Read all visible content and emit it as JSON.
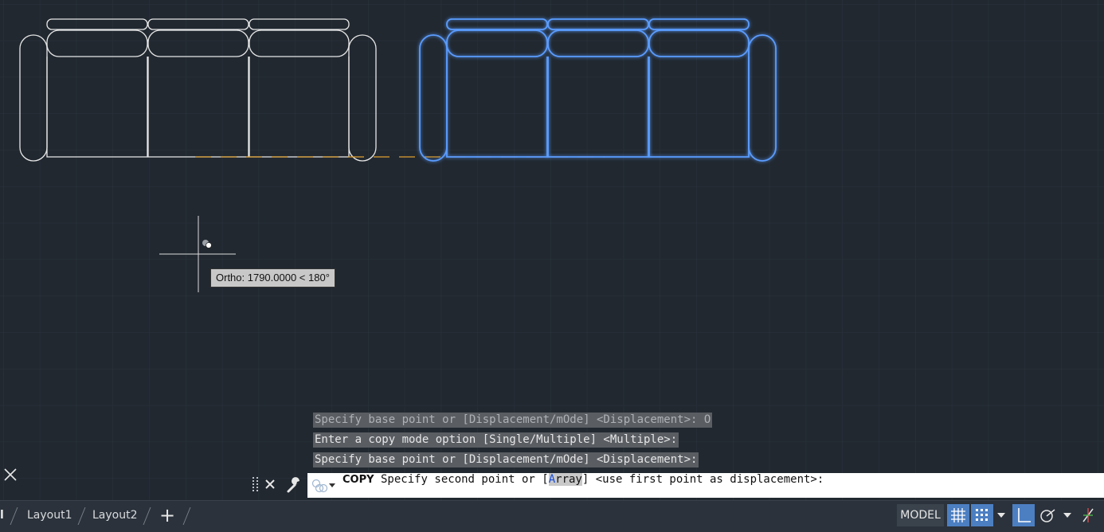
{
  "drawing": {
    "tooltip": "Ortho: 1790.0000 < 180°"
  },
  "command_history": [
    "Specify base point or [Displacement/mOde] <Displacement>: O",
    "Enter a copy mode option [Single/Multiple] <Multiple>:",
    "Specify base point or [Displacement/mOde] <Displacement>:"
  ],
  "command_line": {
    "command": "COPY",
    "prompt_before": "Specify second point or [",
    "option_key": "A",
    "option_rest": "rray",
    "prompt_after": "] <use first point as displacement>:"
  },
  "layout_tabs": [
    {
      "label": "l"
    },
    {
      "label": "Layout1"
    },
    {
      "label": "Layout2"
    }
  ],
  "status_bar": {
    "model_label": "MODEL"
  },
  "icons": {
    "close": "close-icon",
    "customize": "wrench-icon",
    "drag": "grip-icon",
    "add": "plus-icon",
    "grid": "grid-icon",
    "snap": "snap-icon",
    "ortho": "ortho-icon",
    "polar": "polar-icon",
    "isodraft": "isodraft-icon"
  },
  "colors": {
    "background": "#212830",
    "selection": "#5a9cff",
    "original": "#e8e8e8",
    "tracking": "#e0a030",
    "status_active": "#4c7fc2"
  }
}
